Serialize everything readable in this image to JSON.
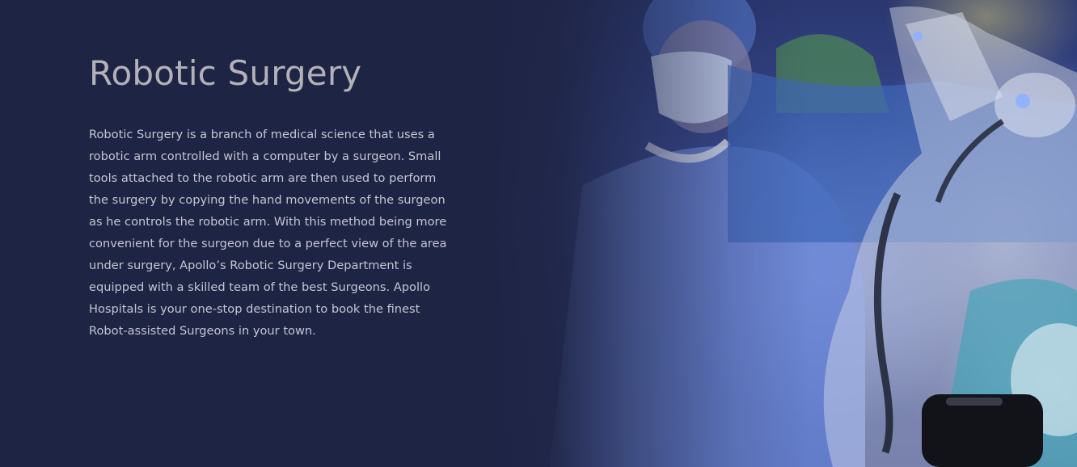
{
  "section": {
    "title": "Robotic Surgery",
    "description": "Robotic Surgery is a branch of medical science that uses a robotic arm controlled with a computer by a surgeon. Small tools attached to the robotic arm are then used to perform the surgery by copying the hand movements of the surgeon as he controls the robotic arm. With this method being more convenient for the surgeon due to a perfect view of the area under surgery, Apollo’s Robotic Surgery Department is equipped with a skilled team of the best Surgeons. Apollo Hospitals is your one-stop destination to book the finest Robot-assisted Surgeons in your town.",
    "background_color": "#1e2444",
    "title_color": "#b3b1b9",
    "text_color": "#c4c6d2"
  },
  "image": {
    "subject": "surgeons operating with robotic surgical arm"
  }
}
